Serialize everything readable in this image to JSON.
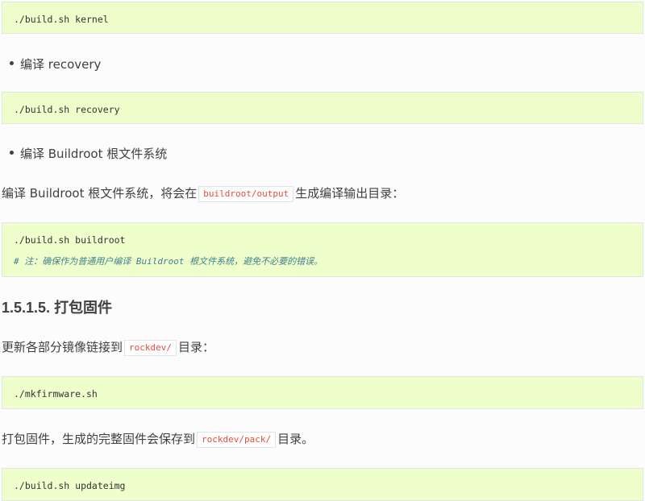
{
  "code_blocks": {
    "kernel": {
      "line": "./build.sh kernel"
    },
    "recovery": {
      "line": "./build.sh recovery"
    },
    "buildroot": {
      "line": "./build.sh buildroot",
      "comment": "# 注：确保作为普通用户编译 Buildroot 根文件系统，避免不必要的错误。"
    },
    "mkfirmware": {
      "line": "./mkfirmware.sh"
    },
    "updateimg": {
      "line": "./build.sh updateimg"
    }
  },
  "bullets": {
    "recovery": "编译 recovery",
    "buildroot": "编译 Buildroot 根文件系统"
  },
  "paragraphs": {
    "buildroot_desc": {
      "before": "编译 Buildroot 根文件系统，将会在",
      "code": "buildroot/output",
      "after": "生成编译输出目录："
    },
    "mkfirmware_desc": {
      "before": "更新各部分镜像链接到",
      "code": "rockdev/",
      "after": "目录："
    },
    "updateimg_desc": {
      "before": "打包固件，生成的完整固件会保存到",
      "code": "rockdev/pack/",
      "after": "目录。"
    }
  },
  "heading": {
    "number": "1.5.1.5.",
    "title": "打包固件"
  }
}
